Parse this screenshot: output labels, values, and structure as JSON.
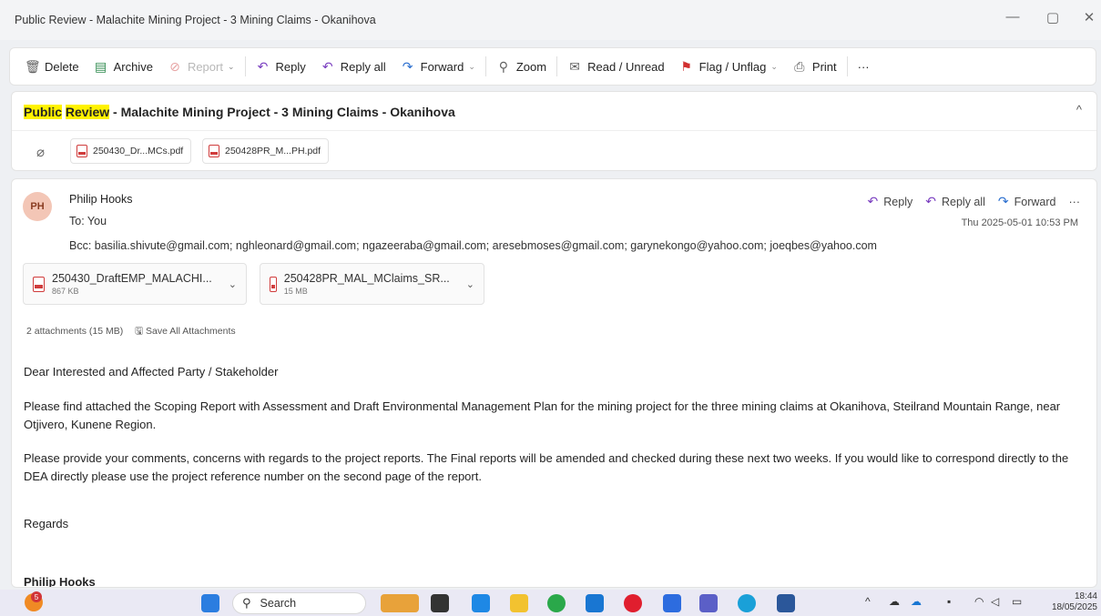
{
  "window": {
    "title": "Public Review - Malachite Mining Project - 3 Mining Claims - Okanihova",
    "minimize": "—",
    "maximize": "▢",
    "close": "✕"
  },
  "toolbar": {
    "delete": "Delete",
    "archive": "Archive",
    "report": "Report",
    "reply": "Reply",
    "reply_all": "Reply all",
    "forward": "Forward",
    "zoom": "Zoom",
    "read_unread": "Read / Unread",
    "flag_unflag": "Flag / Unflag",
    "print": "Print",
    "more": "···"
  },
  "subject": {
    "highlight_1": "Public",
    "highlight_2": "Review",
    "rest": " - Malachite Mining Project - 3 Mining Claims - Okanihova",
    "collapse": "^"
  },
  "mini_attachments": [
    "250430_Dr...MCs.pdf",
    "250428PR_M...PH.pdf"
  ],
  "message": {
    "avatar_initials": "PH",
    "sender": "Philip Hooks",
    "to": "To:  You",
    "bcc": "Bcc:  basilia.shivute@gmail.com;  nghleonard@gmail.com;  ngazeeraba@gmail.com;  aresebmoses@gmail.com;  garynekongo@yahoo.com;  joeqbes@yahoo.com",
    "reply": "Reply",
    "reply_all": "Reply all",
    "forward": "Forward",
    "more": "···",
    "timestamp": "Thu 2025-05-01 10:53 PM",
    "attachments": [
      {
        "name": "250430_DraftEMP_MALACHI...",
        "size": "867 KB"
      },
      {
        "name": "250428PR_MAL_MClaims_SR...",
        "size": "15 MB"
      }
    ],
    "attachment_summary": "2 attachments (15 MB)",
    "save_all": "Save All Attachments",
    "greeting": "Dear Interested and Affected Party / Stakeholder",
    "paragraph_1": "Please find attached the Scoping Report with Assessment and Draft Environmental Management Plan for the mining project for the three mining claims at Okanihova, Steilrand Mountain Range, near Otjivero, Kunene Region.",
    "paragraph_2": "Please provide your comments, concerns with regards to the project reports. The Final reports will be amended and checked during these next two weeks. If you would like to correspond directly to the DEA directly please use the project reference number on the second page of the report.",
    "closing": "Regards",
    "signature": "Philip Hooks"
  },
  "taskbar": {
    "search_label": "Search",
    "weather_badge": "5",
    "time": "18:44",
    "date": "18/05/2025"
  },
  "colors": {
    "accent_blue": "#2b6fcf",
    "reply_all_purple": "#7a3fc0",
    "flag_red": "#d12f2f",
    "highlight": "#fff200",
    "avatar_bg": "#f3c6b6"
  }
}
